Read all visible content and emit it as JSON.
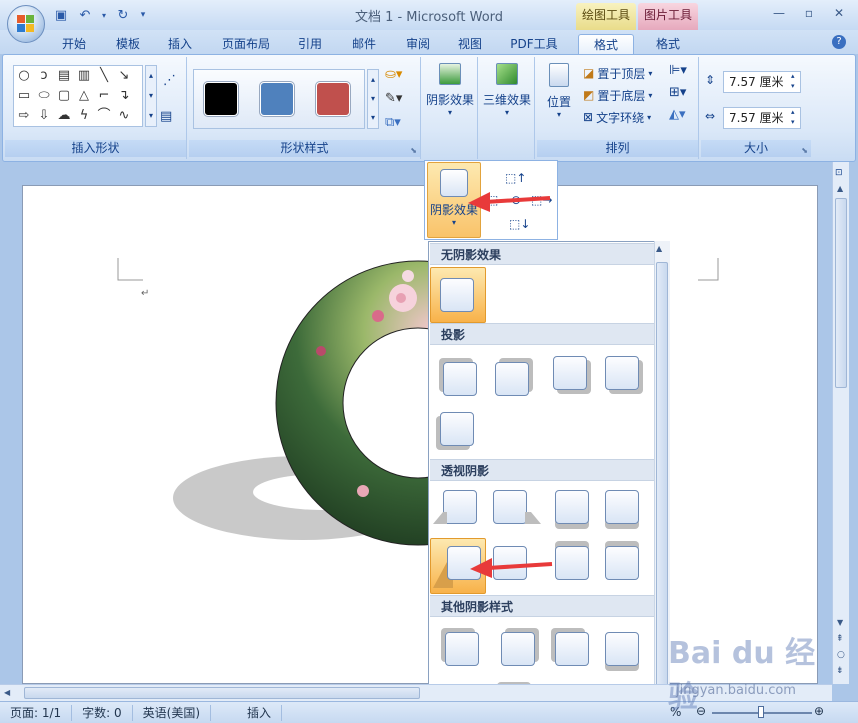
{
  "window": {
    "title": "文档 1 - Microsoft Word"
  },
  "context_tabs": {
    "drawing_tools": "绘图工具",
    "picture_tools": "图片工具"
  },
  "tabs": [
    {
      "label": "开始"
    },
    {
      "label": "模板"
    },
    {
      "label": "插入"
    },
    {
      "label": "页面布局"
    },
    {
      "label": "引用"
    },
    {
      "label": "邮件"
    },
    {
      "label": "审阅"
    },
    {
      "label": "视图"
    },
    {
      "label": "PDF工具"
    },
    {
      "label": "格式",
      "active": true
    },
    {
      "label": "格式"
    }
  ],
  "ribbon": {
    "insert_shapes": {
      "label": "插入形状"
    },
    "shape_styles": {
      "label": "形状样式",
      "swatches": [
        "#000000",
        "#4f81bd",
        "#c0504d"
      ]
    },
    "shadow_effects": {
      "label": "阴影效果"
    },
    "3d_effects": {
      "label": "三维效果"
    },
    "arrange": {
      "label": "排列",
      "position": "位置",
      "bring_front": "置于顶层",
      "send_back": "置于底层",
      "text_wrap": "文字环绕"
    },
    "size": {
      "label": "大小",
      "height": "7.57 厘米",
      "width": "7.57 厘米"
    }
  },
  "shadow_dropdown": {
    "button_label": "阴影效果",
    "sections": {
      "none": "无阴影效果",
      "drop": "投影",
      "perspective": "透视阴影",
      "other": "其他阴影样式"
    }
  },
  "statusbar": {
    "page": "页面: 1/1",
    "words": "字数: 0",
    "language": "英语(美国)",
    "mode": "插入",
    "zoom": "%"
  },
  "watermark": {
    "brand": "Bai du 经验",
    "url": "jingyan.baidu.com"
  }
}
